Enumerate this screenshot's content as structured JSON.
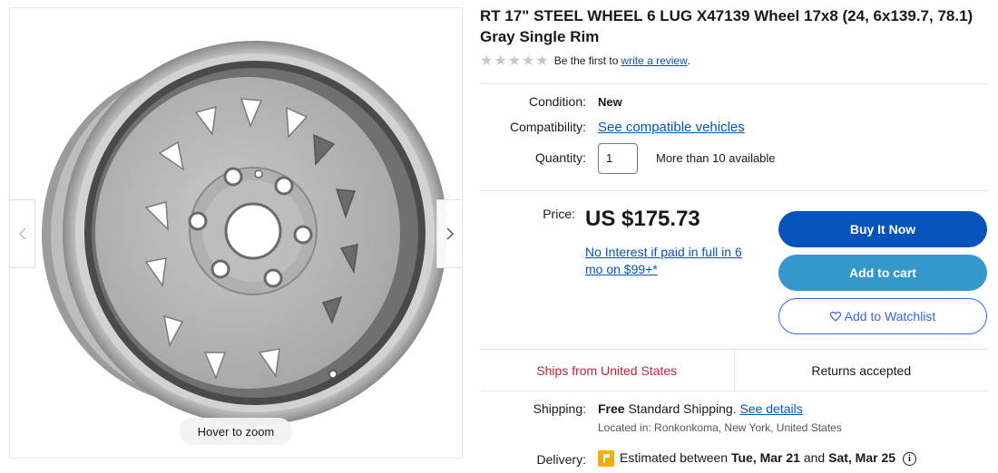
{
  "gallery": {
    "zoom_hint": "Hover to zoom",
    "prev_icon": "chevron-left-icon",
    "next_icon": "chevron-right-icon"
  },
  "product": {
    "title": "RT 17\" STEEL WHEEL 6 LUG X47139 Wheel 17x8 (24, 6x139.7, 78.1) Gray Single Rim",
    "rating_stars": 0,
    "review_prefix": "Be the first to",
    "review_link": "write a review",
    "review_suffix": "."
  },
  "details": {
    "condition_label": "Condition:",
    "condition_value": "New",
    "compatibility_label": "Compatibility:",
    "compatibility_link": "See compatible vehicles",
    "quantity_label": "Quantity:",
    "quantity_value": "1",
    "availability": "More than 10 available"
  },
  "pricing": {
    "price_label": "Price:",
    "price": "US $175.73",
    "financing_link": "No Interest if paid in full in 6 mo on $99+*"
  },
  "actions": {
    "buy_now": "Buy It Now",
    "add_to_cart": "Add to cart",
    "watchlist_icon": "heart-icon",
    "add_to_watchlist": "Add to Watchlist"
  },
  "badges": {
    "ships_from": "Ships from United States",
    "returns": "Returns accepted"
  },
  "shipping": {
    "label": "Shipping:",
    "free": "Free",
    "method": "Standard Shipping.",
    "details_link": "See details",
    "location": "Located in: Ronkonkoma, New York, United States"
  },
  "delivery": {
    "label": "Delivery:",
    "prefix": "Estimated between",
    "date_start": "Tue, Mar 21",
    "and": "and",
    "date_end": "Sat, Mar 25"
  },
  "colors": {
    "primary_blue": "#0654ba",
    "cart_blue": "#3498ca",
    "link_blue": "#0654ba",
    "ships_red": "#c0243a"
  }
}
